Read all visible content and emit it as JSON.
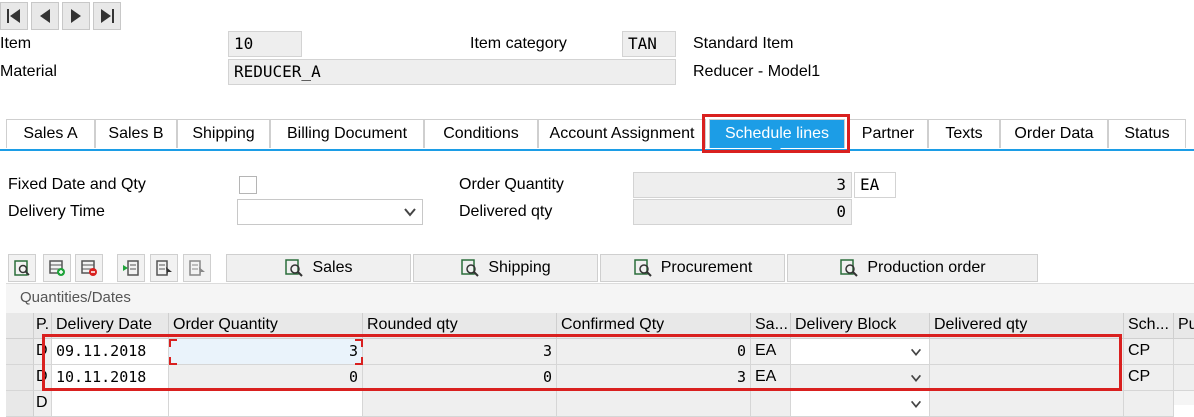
{
  "nav": {
    "first": "first-page",
    "prev": "previous-page",
    "next": "next-page",
    "last": "last-page"
  },
  "header": {
    "item_label": "Item",
    "item_value": "10",
    "item_category_label": "Item category",
    "item_category_value": "TAN",
    "item_category_text": "Standard Item",
    "material_label": "Material",
    "material_value": "REDUCER_A",
    "material_text": "Reducer - Model1"
  },
  "tabs": [
    {
      "label": "Sales A"
    },
    {
      "label": "Sales B"
    },
    {
      "label": "Shipping"
    },
    {
      "label": "Billing Document"
    },
    {
      "label": "Conditions"
    },
    {
      "label": "Account Assignment"
    },
    {
      "label": "Schedule lines",
      "active": true
    },
    {
      "label": "Partner"
    },
    {
      "label": "Texts"
    },
    {
      "label": "Order Data"
    },
    {
      "label": "Status"
    }
  ],
  "form": {
    "fixed_date_label": "Fixed Date and Qty",
    "fixed_date_checked": false,
    "delivery_time_label": "Delivery Time",
    "delivery_time_value": "",
    "order_qty_label": "Order Quantity",
    "order_qty_value": "3",
    "order_qty_unit": "EA",
    "delivered_qty_label": "Delivered qty",
    "delivered_qty_value": "0"
  },
  "toolbar": {
    "sales_label": "Sales",
    "shipping_label": "Shipping",
    "procurement_label": "Procurement",
    "production_order_label": "Production order"
  },
  "table": {
    "title": "Quantities/Dates",
    "headers": {
      "p": "P.",
      "delivery_date": "Delivery Date",
      "order_quantity": "Order Quantity",
      "rounded_qty": "Rounded qty",
      "confirmed_qty": "Confirmed Qty",
      "sa": "Sa...",
      "delivery_block": "Delivery Block",
      "delivered_qty": "Delivered qty",
      "sch": "Sch...",
      "pu": "Pu"
    },
    "rows": [
      {
        "p": "D",
        "delivery_date": "09.11.2018",
        "order_quantity": "3",
        "rounded_qty": "3",
        "confirmed_qty": "0",
        "sa": "EA",
        "delivery_block": "",
        "delivered_qty": "",
        "sch": "CP",
        "pu": ""
      },
      {
        "p": "D",
        "delivery_date": "10.11.2018",
        "order_quantity": "0",
        "rounded_qty": "0",
        "confirmed_qty": "3",
        "sa": "EA",
        "delivery_block": "",
        "delivered_qty": "",
        "sch": "CP",
        "pu": ""
      },
      {
        "p": "D",
        "delivery_date": "",
        "order_quantity": "",
        "rounded_qty": "",
        "confirmed_qty": "",
        "sa": "",
        "delivery_block": "",
        "delivered_qty": "",
        "sch": "",
        "pu": ""
      }
    ]
  },
  "colors": {
    "accent": "#1c9de6",
    "highlight": "#d9201f"
  }
}
